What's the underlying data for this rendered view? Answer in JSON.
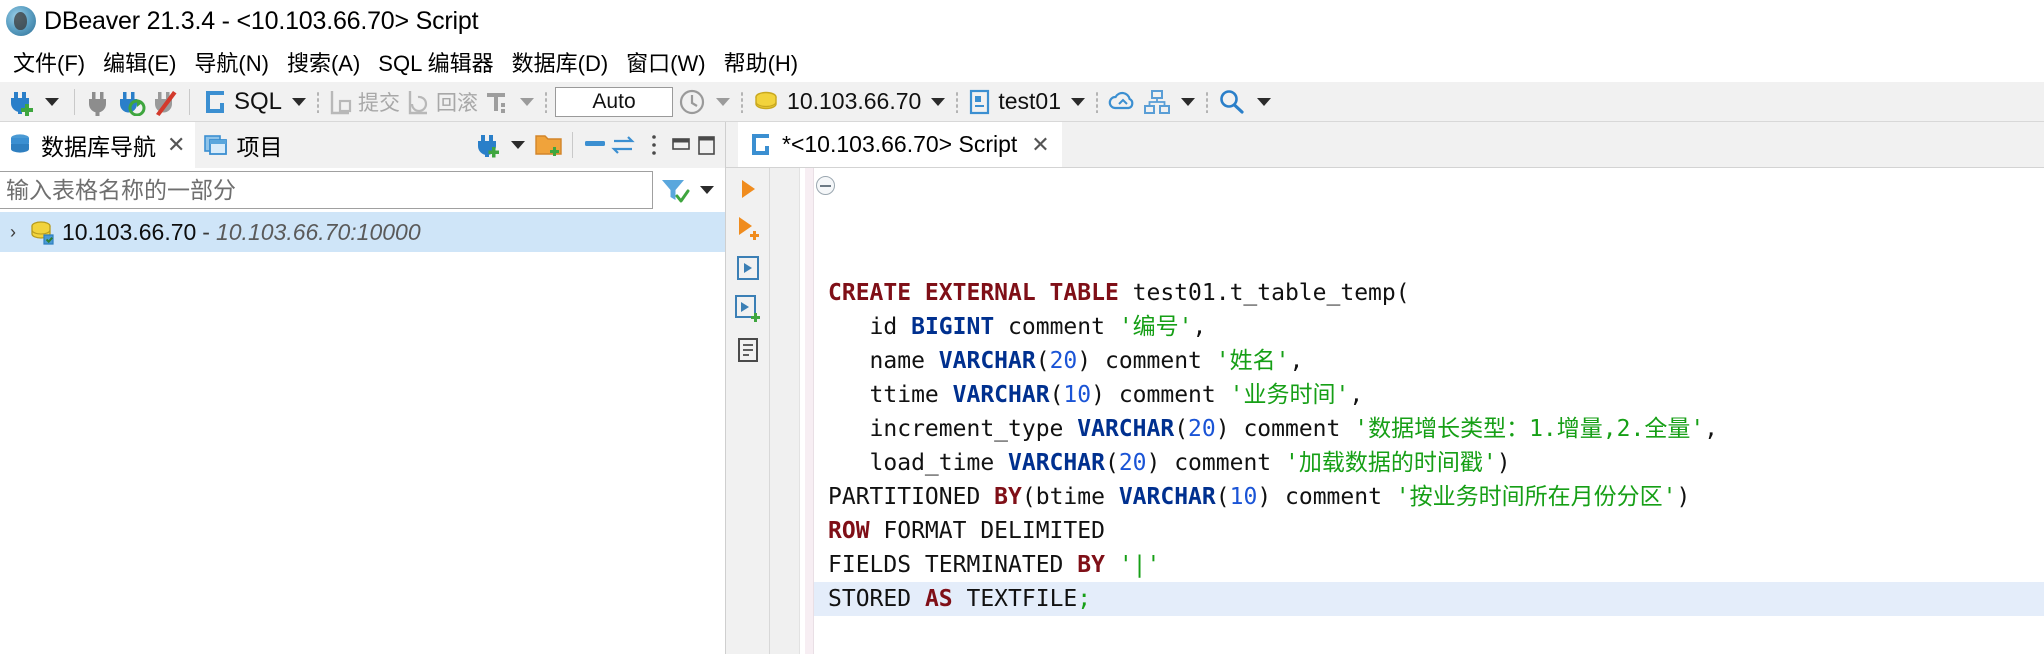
{
  "window": {
    "title": "DBeaver 21.3.4 - <10.103.66.70> Script",
    "icon": "dbeaver-app-icon"
  },
  "menubar": {
    "items": [
      {
        "label": "文件(F)",
        "name": "menu-file"
      },
      {
        "label": "编辑(E)",
        "name": "menu-edit"
      },
      {
        "label": "导航(N)",
        "name": "menu-navigate"
      },
      {
        "label": "搜索(A)",
        "name": "menu-search"
      },
      {
        "label": "SQL 编辑器",
        "name": "menu-sql-editor"
      },
      {
        "label": "数据库(D)",
        "name": "menu-database"
      },
      {
        "label": "窗口(W)",
        "name": "menu-window"
      },
      {
        "label": "帮助(H)",
        "name": "menu-help"
      }
    ]
  },
  "toolbar": {
    "new_connection_icon": "new-connection-plug-plus-icon",
    "new_connection_caret": "chevron-down-icon",
    "disconnect_icon": "disconnect-plug-icon",
    "reconnect_icon": "refresh-plug-icon",
    "invalidate_icon": "disconnect-red-slash-icon",
    "sql_editor_icon": "sql-editor-icon",
    "sql_label": "SQL",
    "sql_caret": "chevron-down-icon",
    "commit_icon": "commit-icon",
    "commit_label": "提交",
    "rollback_icon": "rollback-icon",
    "rollback_label": "回滚",
    "transaction_mode_icon": "transaction-mode-icon",
    "transaction_caret": "chevron-down-icon",
    "auto_value": "Auto",
    "history_icon": "clock-history-icon",
    "history_caret": "chevron-down-icon",
    "connection_icon": "database-connection-icon",
    "connection_value": "10.103.66.70",
    "connection_caret": "chevron-down-icon",
    "schema_icon": "schema-icon",
    "schema_value": "test01",
    "schema_caret": "chevron-down-icon",
    "cloud_icon": "cloud-icon",
    "diagram_icon": "er-diagram-icon",
    "diagram_caret": "chevron-down-icon",
    "search_icon": "search-icon",
    "search_caret": "chevron-down-icon"
  },
  "left_panel": {
    "tabs": [
      {
        "label": "数据库导航",
        "name": "tab-database-navigator",
        "icon": "database-stack-icon",
        "closable": true,
        "active": true
      },
      {
        "label": "项目",
        "name": "tab-projects",
        "icon": "projects-icon",
        "closable": false,
        "active": false
      }
    ],
    "close_glyph": "✕",
    "tools": {
      "new_connection_icon": "new-connection-plug-plus-icon",
      "new_connection_caret": "chevron-down-icon",
      "new_folder_icon": "new-folder-plus-icon",
      "collapse_all_icon": "collapse-all-icon",
      "link_editor_icon": "link-with-editor-icon",
      "view_menu_icon": "view-menu-icon",
      "minimize_icon": "minimize-icon",
      "maximize_icon": "maximize-icon"
    },
    "filter": {
      "placeholder": "输入表格名称的一部分",
      "value": "",
      "filter_icon": "filter-funnel-icon",
      "filter_caret": "chevron-down-icon"
    },
    "tree": [
      {
        "expander": "›",
        "icon": "database-connection-icon",
        "label": "10.103.66.70",
        "separator": "-",
        "sublabel": "10.103.66.70:10000",
        "selected": true,
        "name": "tree-item-connection"
      }
    ]
  },
  "editor": {
    "tabs": [
      {
        "label": "*<10.103.66.70> Script",
        "name": "tab-sql-script",
        "icon": "sql-script-icon",
        "active": true,
        "closable": true
      }
    ],
    "close_glyph": "✕",
    "vertical_toolbar": [
      {
        "name": "execute-sql-statement-button",
        "icon": "execute-play-icon"
      },
      {
        "name": "execute-sql-script-button",
        "icon": "execute-script-play-plus-icon"
      },
      {
        "name": "execute-in-new-tab-button",
        "icon": "execute-new-tab-icon"
      },
      {
        "name": "execute-script-export-button",
        "icon": "execute-export-icon"
      },
      {
        "name": "explain-execution-plan-button",
        "icon": "execution-plan-icon"
      }
    ],
    "fold_marker": "collapse-block-icon",
    "code_lines": [
      {
        "highlighted": false,
        "fold": true,
        "tokens": [
          {
            "t": "CREATE EXTERNAL TABLE ",
            "c": "kw"
          },
          {
            "t": "test01.t_table_temp(",
            "c": "pl"
          }
        ]
      },
      {
        "highlighted": false,
        "tokens": [
          {
            "t": "   id ",
            "c": "pl"
          },
          {
            "t": "BIGINT",
            "c": "typ"
          },
          {
            "t": " comment ",
            "c": "pl"
          },
          {
            "t": "'编号'",
            "c": "str"
          },
          {
            "t": ",",
            "c": "pl"
          }
        ]
      },
      {
        "highlighted": false,
        "tokens": [
          {
            "t": "   name ",
            "c": "pl"
          },
          {
            "t": "VARCHAR",
            "c": "typ"
          },
          {
            "t": "(",
            "c": "pl"
          },
          {
            "t": "20",
            "c": "num"
          },
          {
            "t": ") comment ",
            "c": "pl"
          },
          {
            "t": "'姓名'",
            "c": "str"
          },
          {
            "t": ",",
            "c": "pl"
          }
        ]
      },
      {
        "highlighted": false,
        "tokens": [
          {
            "t": "   ttime ",
            "c": "pl"
          },
          {
            "t": "VARCHAR",
            "c": "typ"
          },
          {
            "t": "(",
            "c": "pl"
          },
          {
            "t": "10",
            "c": "num"
          },
          {
            "t": ") comment ",
            "c": "pl"
          },
          {
            "t": "'业务时间'",
            "c": "str"
          },
          {
            "t": ",",
            "c": "pl"
          }
        ]
      },
      {
        "highlighted": false,
        "tokens": [
          {
            "t": "   increment_type ",
            "c": "pl"
          },
          {
            "t": "VARCHAR",
            "c": "typ"
          },
          {
            "t": "(",
            "c": "pl"
          },
          {
            "t": "20",
            "c": "num"
          },
          {
            "t": ") comment ",
            "c": "pl"
          },
          {
            "t": "'数据增长类型：1.增量,2.全量'",
            "c": "str"
          },
          {
            "t": ",",
            "c": "pl"
          }
        ]
      },
      {
        "highlighted": false,
        "tokens": [
          {
            "t": "   load_time ",
            "c": "pl"
          },
          {
            "t": "VARCHAR",
            "c": "typ"
          },
          {
            "t": "(",
            "c": "pl"
          },
          {
            "t": "20",
            "c": "num"
          },
          {
            "t": ") comment ",
            "c": "pl"
          },
          {
            "t": "'加载数据的时间戳'",
            "c": "str"
          },
          {
            "t": ")",
            "c": "pl"
          }
        ]
      },
      {
        "highlighted": false,
        "tokens": [
          {
            "t": "PARTITIONED ",
            "c": "pl"
          },
          {
            "t": "BY",
            "c": "kw"
          },
          {
            "t": "(btime ",
            "c": "pl"
          },
          {
            "t": "VARCHAR",
            "c": "typ"
          },
          {
            "t": "(",
            "c": "pl"
          },
          {
            "t": "10",
            "c": "num"
          },
          {
            "t": ") comment ",
            "c": "pl"
          },
          {
            "t": "'按业务时间所在月份分区'",
            "c": "str"
          },
          {
            "t": ")",
            "c": "pl"
          }
        ]
      },
      {
        "highlighted": false,
        "tokens": [
          {
            "t": "ROW",
            "c": "kw"
          },
          {
            "t": " FORMAT DELIMITED",
            "c": "pl"
          }
        ]
      },
      {
        "highlighted": false,
        "tokens": [
          {
            "t": "FIELDS TERMINATED ",
            "c": "pl"
          },
          {
            "t": "BY",
            "c": "kw"
          },
          {
            "t": " ",
            "c": "pl"
          },
          {
            "t": "'|'",
            "c": "str"
          }
        ]
      },
      {
        "highlighted": true,
        "tokens": [
          {
            "t": "STORED ",
            "c": "pl"
          },
          {
            "t": "AS",
            "c": "kw"
          },
          {
            "t": " TEXTFILE",
            "c": "pl"
          },
          {
            "t": ";",
            "c": "str"
          }
        ]
      }
    ]
  },
  "colors": {
    "keyword": "#7f0f17",
    "type": "#00308f",
    "string": "#169f16",
    "number": "#1a54d6",
    "selection": "#cfe5f8",
    "line_highlight": "#e4edfa",
    "toolbar_bg": "#f1f1f1"
  }
}
